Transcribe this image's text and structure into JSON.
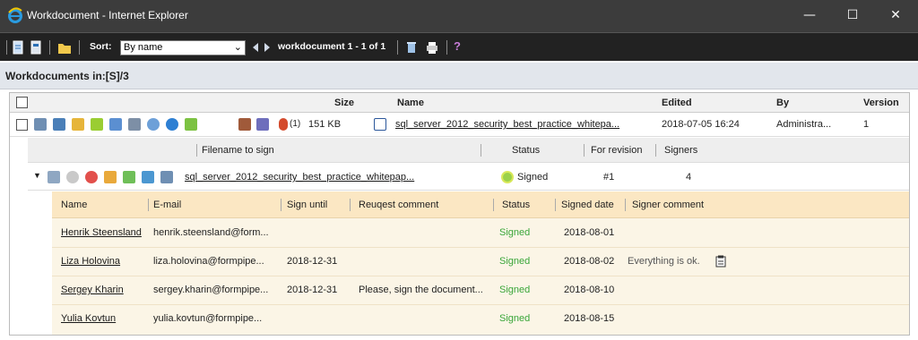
{
  "window": {
    "title": "Workdocument - Internet Explorer",
    "min": "—",
    "max": "☐",
    "close": "✕"
  },
  "toolbar": {
    "sort_label": "Sort:",
    "sort_value": "By name",
    "sort_arrow": "⌄",
    "nav_text": "workdocument 1 - 1 of 1",
    "help": "?"
  },
  "heading": "Workdocuments in:[S]/3",
  "columns": {
    "size": "Size",
    "name": "Name",
    "edited": "Edited",
    "by": "By",
    "version": "Version"
  },
  "document": {
    "signatures": "(1)",
    "size": "151 KB",
    "name": "sql_server_2012_security_best_practice_whitepa...",
    "edited": "2018-07-05 16:24",
    "by": "Administra...",
    "version": "1"
  },
  "sign_header": {
    "filename": "Filename to sign",
    "status": "Status",
    "revision": "For revision",
    "signers": "Signers"
  },
  "sign_row": {
    "filename": "sql_server_2012_security_best_practice_whitepap...",
    "status": "Signed",
    "revision": "#1",
    "signers": "4"
  },
  "signer_header": {
    "name": "Name",
    "email": "E-mail",
    "sign_until": "Sign until",
    "request_comment": "Reuqest comment",
    "status": "Status",
    "signed_date": "Signed date",
    "signer_comment": "Signer comment"
  },
  "signers": [
    {
      "name": "Henrik Steensland",
      "email": "henrik.steensland@form...",
      "sign_until": "",
      "request_comment": "",
      "status": "Signed",
      "signed_date": "2018-08-01",
      "signer_comment": ""
    },
    {
      "name": "Liza Holovina",
      "email": "liza.holovina@formpipe...",
      "sign_until": "2018-12-31",
      "request_comment": "",
      "status": "Signed",
      "signed_date": "2018-08-02",
      "signer_comment": "Everything is ok."
    },
    {
      "name": "Sergey Kharin",
      "email": "sergey.kharin@formpipe...",
      "sign_until": "2018-12-31",
      "request_comment": "Please, sign the document...",
      "status": "Signed",
      "signed_date": "2018-08-10",
      "signer_comment": ""
    },
    {
      "name": "Yulia Kovtun",
      "email": "yulia.kovtun@formpipe...",
      "sign_until": "",
      "request_comment": "",
      "status": "Signed",
      "signed_date": "2018-08-15",
      "signer_comment": ""
    }
  ],
  "colors": {
    "titlebar": "#3c3c3c",
    "toolbar": "#222222",
    "status_signed": "#3aa63a",
    "signer_panel": "#fbf5e6"
  }
}
